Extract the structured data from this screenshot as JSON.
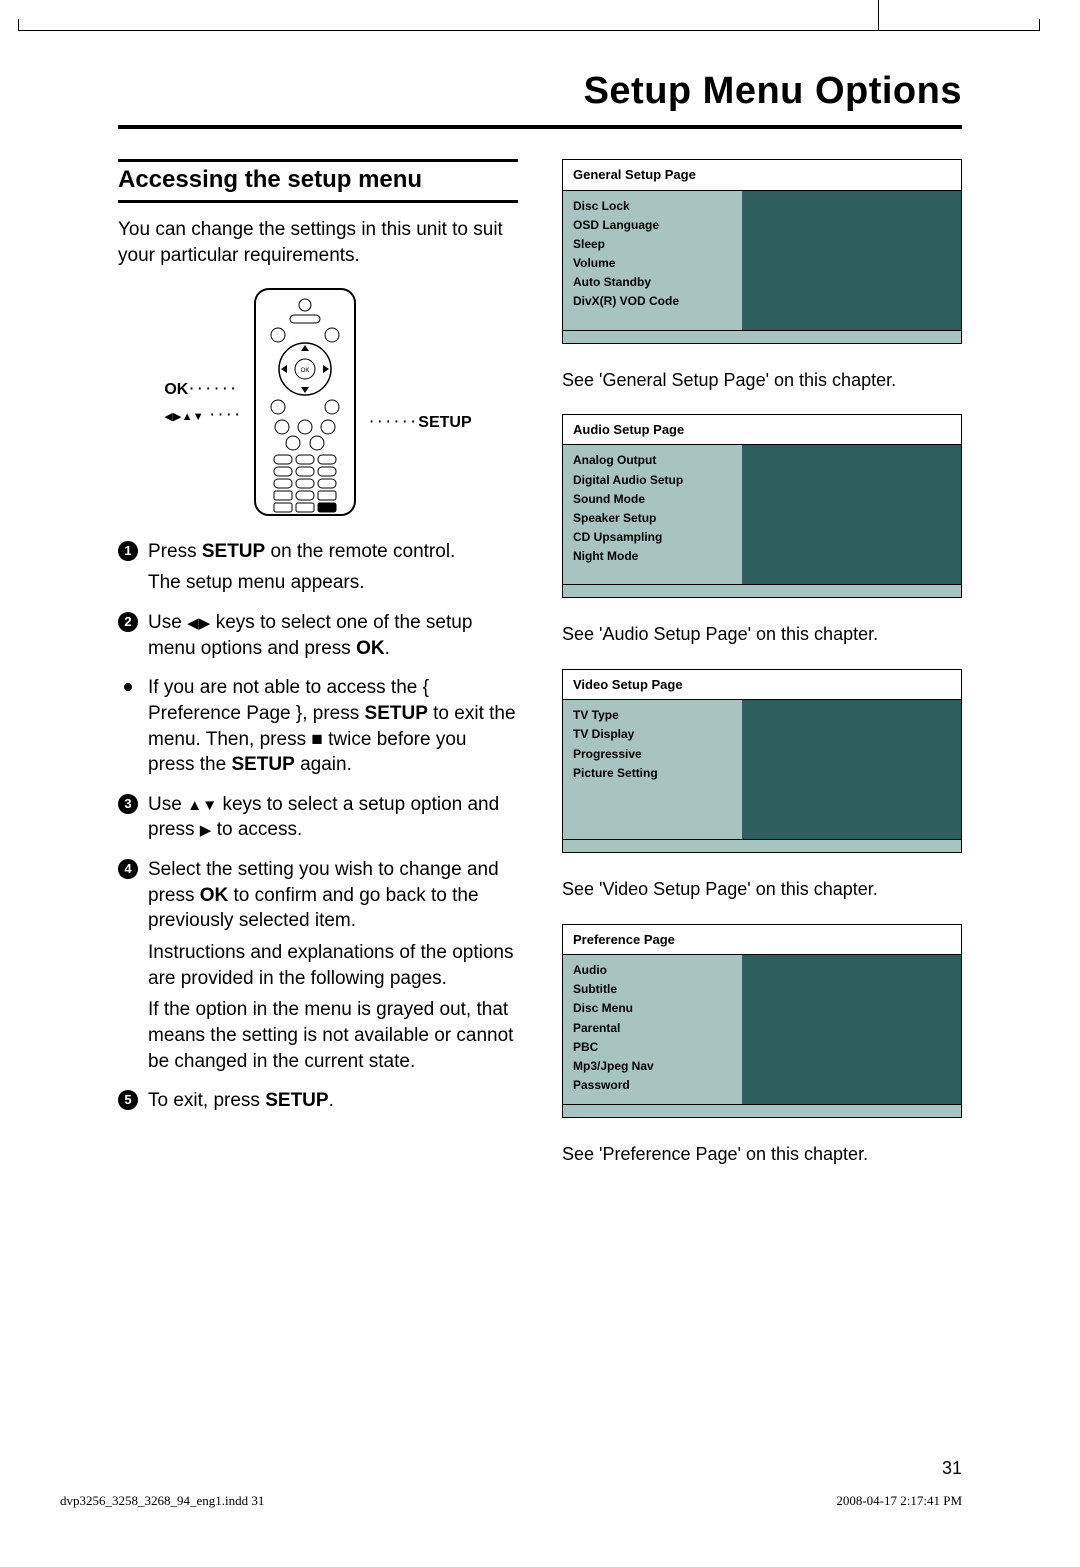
{
  "page": {
    "title": "Setup Menu Options",
    "number": "31"
  },
  "left": {
    "heading": "Accessing the setup menu",
    "intro": "You can change the settings in this unit to suit your particular requirements.",
    "remote": {
      "ok_label": "OK",
      "setup_label": "SETUP"
    },
    "steps": {
      "s1_a": "Press ",
      "s1_b_bold": "SETUP",
      "s1_c": " on the remote control.",
      "s1_sub": "The setup menu appears.",
      "s2_a": "Use ",
      "s2_b": " keys to select one of the setup menu options and press ",
      "s2_c_bold": "OK",
      "s2_d": ".",
      "bullet_a": "If you are not able to access the { Preference Page }, press ",
      "bullet_b_bold": "SETUP",
      "bullet_c": " to exit the menu. Then, press ",
      "bullet_d": " twice before you press the ",
      "bullet_e_bold": "SETUP",
      "bullet_f": " again.",
      "s3_a": "Use ",
      "s3_b": " keys to select a setup option and press ",
      "s3_c": " to access.",
      "s4_a": "Select the setting you wish to change and press ",
      "s4_b_bold": "OK",
      "s4_c": " to confirm and go back to the previously selected item.",
      "s4_sub1": "Instructions and explanations of the options are provided in the following pages.",
      "s4_sub2": "If the option in the menu is grayed out, that means the setting is not available or cannot be changed in the current state.",
      "s5_a": "To exit, press ",
      "s5_b_bold": "SETUP",
      "s5_c": "."
    }
  },
  "right": {
    "menus": [
      {
        "title": "General Setup Page",
        "items": [
          "Disc Lock",
          "OSD Language",
          "Sleep",
          "Volume",
          "Auto Standby",
          "DivX(R) VOD Code"
        ],
        "caption": "See 'General Setup Page' on this chapter."
      },
      {
        "title": "Audio Setup Page",
        "items": [
          "Analog Output",
          "Digital Audio Setup",
          "Sound Mode",
          "Speaker Setup",
          "CD Upsampling",
          "Night Mode"
        ],
        "caption": "See 'Audio Setup Page' on this chapter."
      },
      {
        "title": "Video Setup Page",
        "items": [
          "TV Type",
          "TV Display",
          "Progressive",
          "Picture Setting"
        ],
        "caption": "See 'Video Setup Page' on this chapter."
      },
      {
        "title": "Preference Page",
        "items": [
          "Audio",
          "Subtitle",
          "Disc Menu",
          "Parental",
          "PBC",
          "Mp3/Jpeg Nav",
          "Password"
        ],
        "caption": "See 'Preference Page' on this chapter."
      }
    ]
  },
  "footer": {
    "left": "dvp3256_3258_3268_94_eng1.indd   31",
    "right": "2008-04-17   2:17:41 PM"
  }
}
